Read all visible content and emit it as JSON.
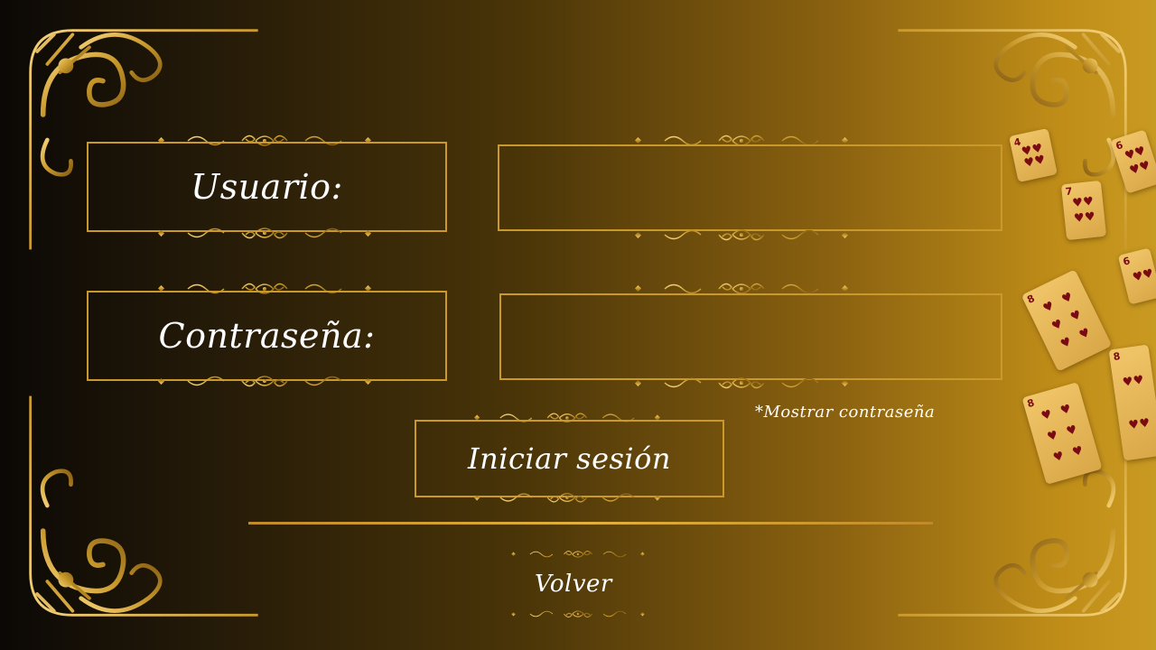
{
  "form": {
    "username_label": "Usuario:",
    "username_value": "",
    "password_label": "Contraseña:",
    "password_value": "",
    "show_password_label": "*Mostrar contraseña",
    "login_button_label": "Iniciar sesión",
    "back_link_label": "Volver"
  },
  "cards": [
    {
      "rank": "4",
      "suit": "♥"
    },
    {
      "rank": "6",
      "suit": "♥"
    },
    {
      "rank": "7",
      "suit": "♥"
    },
    {
      "rank": "6",
      "suit": "♥"
    },
    {
      "rank": "8",
      "suit": "♥"
    },
    {
      "rank": "8",
      "suit": "♥"
    },
    {
      "rank": "8",
      "suit": "♥"
    }
  ],
  "colors": {
    "gold": "#c9992b",
    "gold_light": "#f0c65a",
    "text": "#ffffff",
    "heart": "#7a0b12"
  }
}
